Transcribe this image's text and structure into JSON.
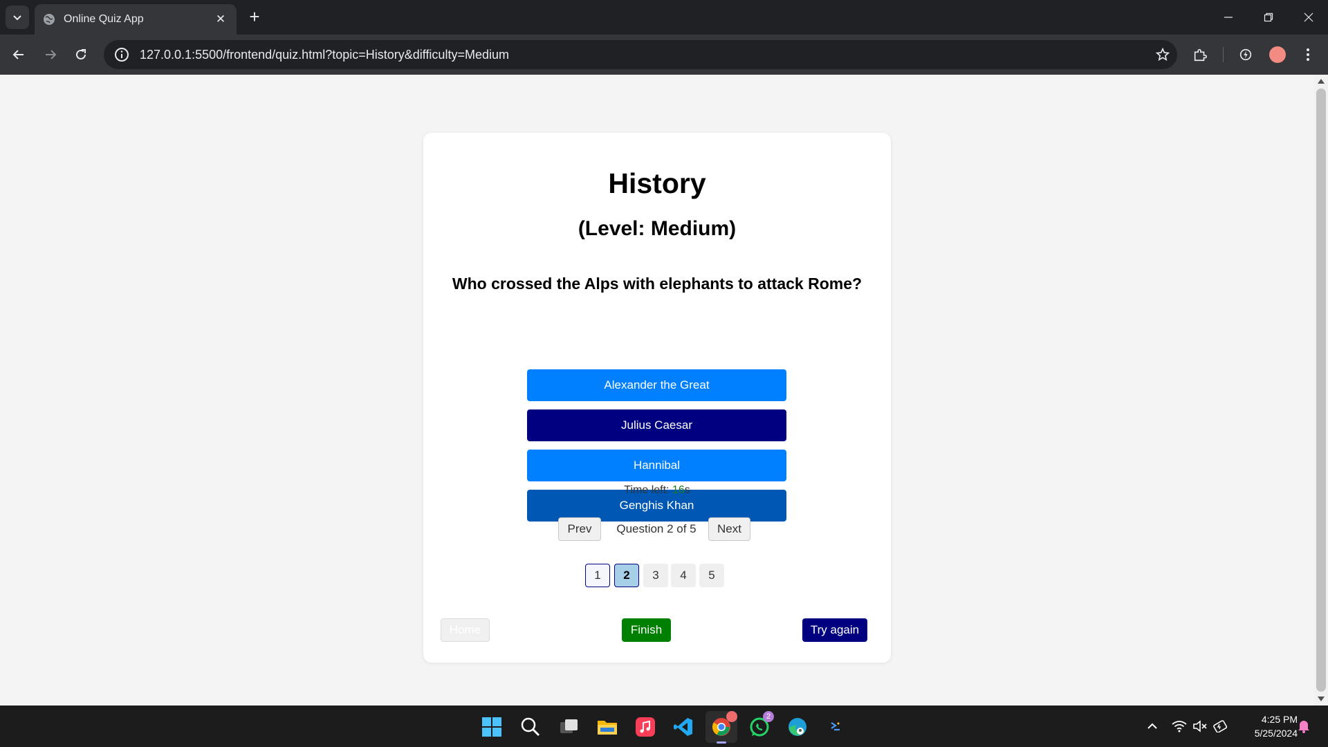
{
  "browser": {
    "tab_title": "Online Quiz App",
    "url": "127.0.0.1:5500/frontend/quiz.html?topic=History&difficulty=Medium"
  },
  "quiz": {
    "topic": "History",
    "level": "(Level: Medium)",
    "question": "Who crossed the Alps with elephants to attack Rome?",
    "options": [
      {
        "label": "Alexander the Great",
        "color": "#0080ff"
      },
      {
        "label": "Julius Caesar",
        "color": "#000080"
      },
      {
        "label": "Hannibal",
        "color": "#0080ff"
      },
      {
        "label": "Genghis Khan",
        "color": "#0058b4"
      }
    ],
    "timer_label": "Time left: ",
    "timer_seconds": "16",
    "timer_unit": "s",
    "prev_label": "Prev",
    "next_label": "Next",
    "question_counter": "Question 2 of 5",
    "numbers": [
      "1",
      "2",
      "3",
      "4",
      "5"
    ],
    "current_question": "2",
    "home_label": "Home",
    "finish_label": "Finish",
    "try_again_label": "Try again"
  },
  "taskbar": {
    "apps": [
      "windows-start-icon",
      "search-icon",
      "task-view-icon",
      "file-explorer-icon",
      "music-app-icon",
      "vscode-icon",
      "chrome-icon",
      "whatsapp-icon",
      "edge-icon",
      "terminal-icon"
    ],
    "whatsapp_badge": "2",
    "time": "4:25 PM",
    "date": "5/25/2024"
  },
  "colors": {
    "accent_blue": "#0080ff",
    "navy": "#000080",
    "finish_green": "#008000",
    "page_bg": "#f4f4f4"
  }
}
